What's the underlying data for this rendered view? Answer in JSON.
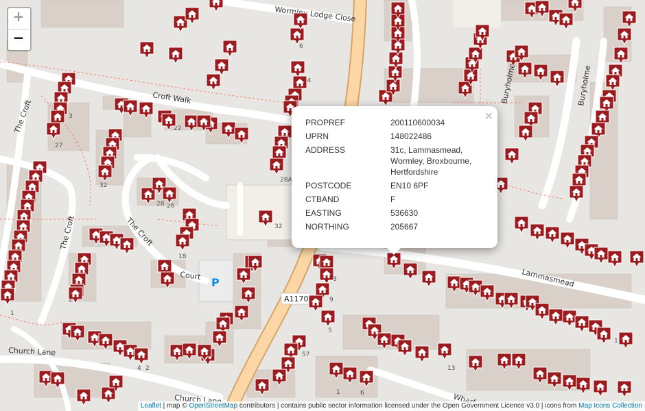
{
  "zoom": {
    "in_label": "+",
    "out_label": "−"
  },
  "labels": {
    "wormley_lodge_close": "Wormley Lodge Close",
    "croft_walk": "Croft Walk",
    "the_croft_1": "The Croft",
    "the_croft_2": "The Croft",
    "the_croft_3": "The Croft",
    "buryholme_1": "Buryholme",
    "buryholme_2": "Buryholme",
    "lammasmead": "Lammasmead",
    "church_lane_1": "Church Lane",
    "church_lane_2": "Church Lane",
    "court": "Court",
    "wharf": "Wharf",
    "road_ref": "A1170",
    "parking": "P"
  },
  "house_numbers": [
    "6",
    "14",
    "3",
    "27",
    "22",
    "32",
    "28",
    "26",
    "28A",
    "32",
    "18",
    "2",
    "1",
    "8",
    "9",
    "5",
    "57",
    "13",
    "6",
    "1",
    "4",
    "2",
    "1"
  ],
  "popup": {
    "close_label": "×",
    "rows": [
      {
        "key": "PROPREF",
        "value": "200110600034"
      },
      {
        "key": "UPRN",
        "value": "148022486"
      },
      {
        "key": "ADDRESS",
        "value": "31c, Lammasmead, Wormley, Broxbourne, Hertfordshire"
      },
      {
        "key": "POSTCODE",
        "value": "EN10 6PF"
      },
      {
        "key": "CTBAND",
        "value": "F"
      },
      {
        "key": "EASTING",
        "value": "536630"
      },
      {
        "key": "NORTHING",
        "value": "205667"
      }
    ]
  },
  "attribution": {
    "leaflet": "Leaflet",
    "sep1": " | map © ",
    "osm": "OpenStreetMap",
    "rest": " contributors | contains public sector information licensed under the Open Government Licence v3.0 | icons from ",
    "icons": "Map Icons Collection"
  },
  "colors": {
    "marker": "#9b1b1f",
    "road_major": "#fcd6a4",
    "road_minor": "#ffffff",
    "building": "#d9d0c9",
    "path": "#fa8072"
  },
  "marker_icon": "house-marker-icon"
}
